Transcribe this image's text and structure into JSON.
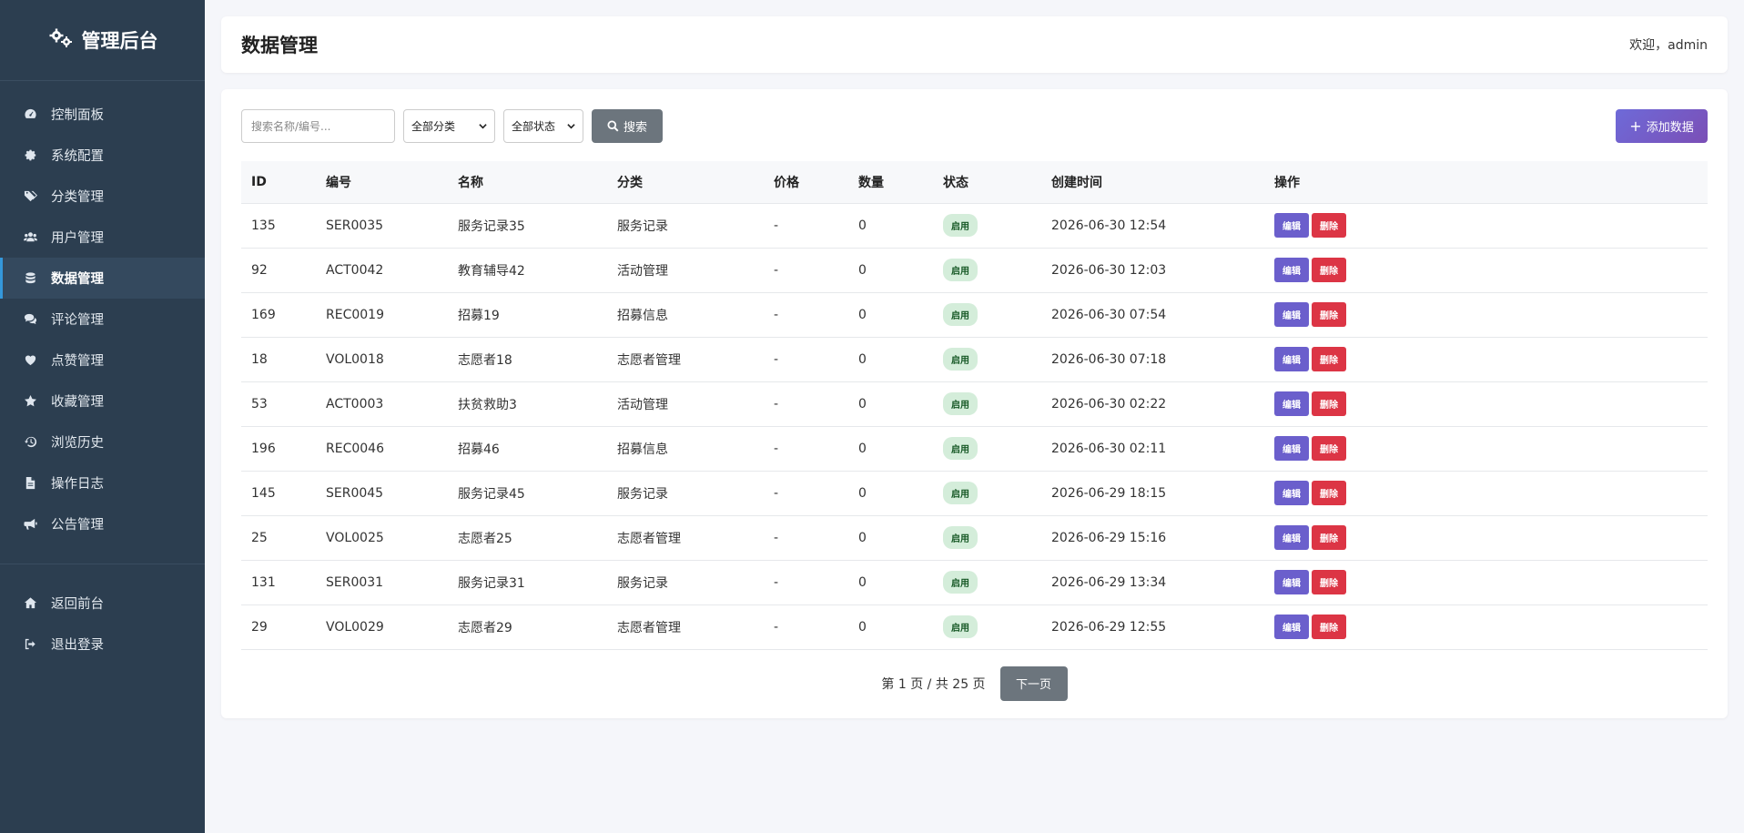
{
  "brand": {
    "title": "管理后台",
    "icon": "gears-icon"
  },
  "sidebar": {
    "items": [
      {
        "label": "控制面板",
        "icon": "dashboard-icon",
        "active": false
      },
      {
        "label": "系统配置",
        "icon": "gear-icon",
        "active": false
      },
      {
        "label": "分类管理",
        "icon": "tags-icon",
        "active": false
      },
      {
        "label": "用户管理",
        "icon": "users-icon",
        "active": false
      },
      {
        "label": "数据管理",
        "icon": "database-icon",
        "active": true
      },
      {
        "label": "评论管理",
        "icon": "comments-icon",
        "active": false
      },
      {
        "label": "点赞管理",
        "icon": "heart-icon",
        "active": false
      },
      {
        "label": "收藏管理",
        "icon": "star-icon",
        "active": false
      },
      {
        "label": "浏览历史",
        "icon": "history-icon",
        "active": false
      },
      {
        "label": "操作日志",
        "icon": "file-icon",
        "active": false
      },
      {
        "label": "公告管理",
        "icon": "bullhorn-icon",
        "active": false
      }
    ],
    "bottom_items": [
      {
        "label": "返回前台",
        "icon": "home-icon"
      },
      {
        "label": "退出登录",
        "icon": "sign-out-icon"
      }
    ]
  },
  "header": {
    "title": "数据管理",
    "welcome": "欢迎，admin"
  },
  "toolbar": {
    "search_placeholder": "搜索名称/编号...",
    "category_select": "全部分类",
    "status_select": "全部状态",
    "search_label": "搜索",
    "add_label": "添加数据"
  },
  "table": {
    "columns": [
      "ID",
      "编号",
      "名称",
      "分类",
      "价格",
      "数量",
      "状态",
      "创建时间",
      "操作"
    ],
    "rows": [
      {
        "id": "135",
        "code": "SER0035",
        "name": "服务记录35",
        "category": "服务记录",
        "price": "-",
        "qty": "0",
        "status": "启用",
        "created": "2026-06-30 12:54"
      },
      {
        "id": "92",
        "code": "ACT0042",
        "name": "教育辅导42",
        "category": "活动管理",
        "price": "-",
        "qty": "0",
        "status": "启用",
        "created": "2026-06-30 12:03"
      },
      {
        "id": "169",
        "code": "REC0019",
        "name": "招募19",
        "category": "招募信息",
        "price": "-",
        "qty": "0",
        "status": "启用",
        "created": "2026-06-30 07:54"
      },
      {
        "id": "18",
        "code": "VOL0018",
        "name": "志愿者18",
        "category": "志愿者管理",
        "price": "-",
        "qty": "0",
        "status": "启用",
        "created": "2026-06-30 07:18"
      },
      {
        "id": "53",
        "code": "ACT0003",
        "name": "扶贫救助3",
        "category": "活动管理",
        "price": "-",
        "qty": "0",
        "status": "启用",
        "created": "2026-06-30 02:22"
      },
      {
        "id": "196",
        "code": "REC0046",
        "name": "招募46",
        "category": "招募信息",
        "price": "-",
        "qty": "0",
        "status": "启用",
        "created": "2026-06-30 02:11"
      },
      {
        "id": "145",
        "code": "SER0045",
        "name": "服务记录45",
        "category": "服务记录",
        "price": "-",
        "qty": "0",
        "status": "启用",
        "created": "2026-06-29 18:15"
      },
      {
        "id": "25",
        "code": "VOL0025",
        "name": "志愿者25",
        "category": "志愿者管理",
        "price": "-",
        "qty": "0",
        "status": "启用",
        "created": "2026-06-29 15:16"
      },
      {
        "id": "131",
        "code": "SER0031",
        "name": "服务记录31",
        "category": "服务记录",
        "price": "-",
        "qty": "0",
        "status": "启用",
        "created": "2026-06-29 13:34"
      },
      {
        "id": "29",
        "code": "VOL0029",
        "name": "志愿者29",
        "category": "志愿者管理",
        "price": "-",
        "qty": "0",
        "status": "启用",
        "created": "2026-06-29 12:55"
      }
    ],
    "edit_label": "编辑",
    "delete_label": "删除"
  },
  "pagination": {
    "info": "第 1 页 / 共 25 页",
    "next_label": "下一页"
  },
  "colors": {
    "sidebar_bg": "#2c3e50",
    "active_border": "#3498db",
    "badge_bg": "#d4edda",
    "edit": "#6b5fcc",
    "delete": "#dc3545"
  }
}
